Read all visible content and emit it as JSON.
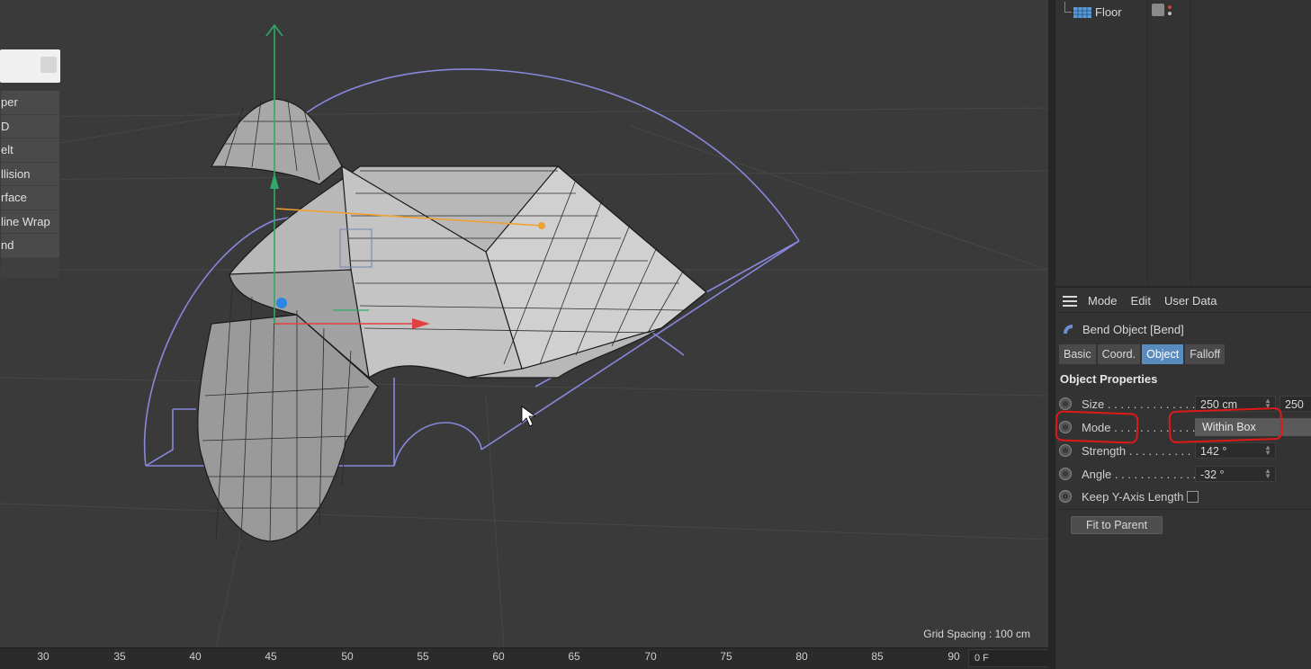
{
  "viewport": {
    "grid_spacing": "Grid Spacing : 100 cm",
    "popup_menu": {
      "items": [
        "per",
        "D",
        "elt",
        "llision",
        "rface",
        "line Wrap",
        "nd"
      ]
    }
  },
  "timeline": {
    "ticks": [
      "30",
      "35",
      "40",
      "45",
      "50",
      "55",
      "60",
      "65",
      "70",
      "75",
      "80",
      "85",
      "90"
    ],
    "current_frame": "0 F"
  },
  "object_manager": {
    "floor_label": "Floor",
    "tag_colors": {
      "dot_top": "#d04040",
      "dot_bottom": "#c0c0c0"
    }
  },
  "attribute_manager": {
    "menu": {
      "mode": "Mode",
      "edit": "Edit",
      "user_data": "User Data"
    },
    "object_title": "Bend Object [Bend]",
    "tabs": [
      {
        "label": "Basic",
        "active": false
      },
      {
        "label": "Coord.",
        "active": false
      },
      {
        "label": "Object",
        "active": true
      },
      {
        "label": "Falloff",
        "active": false
      }
    ],
    "section_heading": "Object Properties",
    "properties": {
      "size": {
        "label": "Size . . . . . . . . . . . . . . .",
        "value": "250 cm",
        "value2": "250"
      },
      "mode": {
        "label": "Mode . . . . . . . . . . . . . .",
        "value": "Within Box"
      },
      "strength": {
        "label": "Strength . . . . . . . . . . .",
        "value": "142 °"
      },
      "angle": {
        "label": "Angle . . . . . . . . . . . . .",
        "value": "-32 °"
      },
      "keep_y": {
        "label": "Keep Y-Axis Length",
        "checked": false
      }
    },
    "fit_button": "Fit to Parent"
  },
  "colors": {
    "active_tab": "#5a8bbf",
    "annotation": "#e01818",
    "deformer_cage": "#8888dd",
    "y_axis": "#2eaa6a",
    "x_axis": "#e04040",
    "z_handle": "#2a88e0",
    "strength_handle": "#f0a030"
  }
}
